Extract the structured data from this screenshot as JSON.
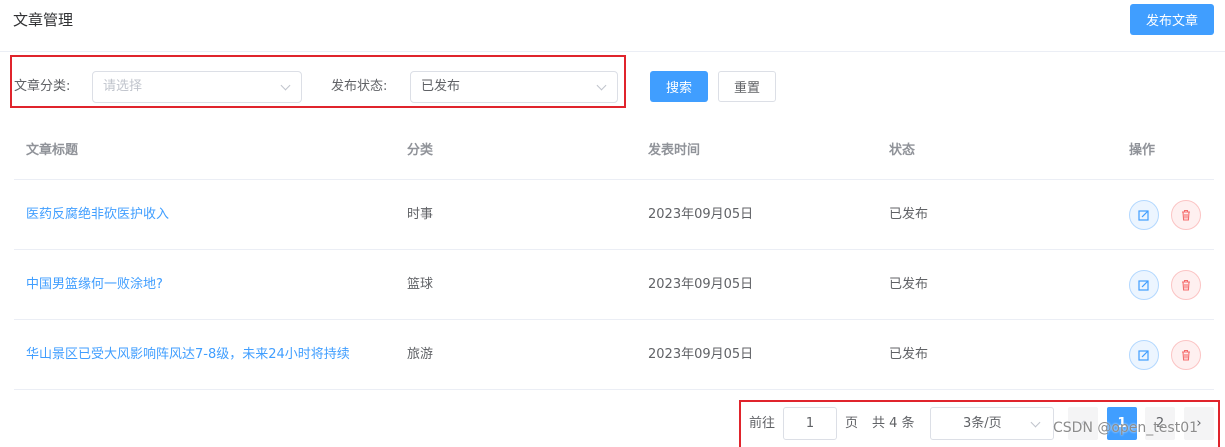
{
  "header": {
    "title": "文章管理",
    "publish_label": "发布文章"
  },
  "filters": {
    "category_label": "文章分类:",
    "category_placeholder": "请选择",
    "status_label": "发布状态:",
    "status_value": "已发布",
    "search_label": "搜索",
    "reset_label": "重置"
  },
  "table": {
    "columns": [
      "文章标题",
      "分类",
      "发表时间",
      "状态",
      "操作"
    ],
    "rows": [
      {
        "title": "医药反腐绝非砍医护收入",
        "category": "时事",
        "date": "2023年09月05日",
        "status": "已发布"
      },
      {
        "title": "中国男篮缘何一败涂地?",
        "category": "篮球",
        "date": "2023年09月05日",
        "status": "已发布"
      },
      {
        "title": "华山景区已受大风影响阵风达7-8级，未来24小时将持续",
        "category": "旅游",
        "date": "2023年09月05日",
        "status": "已发布"
      }
    ]
  },
  "pagination": {
    "goto_label": "前往",
    "goto_value": "1",
    "page_unit": "页",
    "total_label": "共 4 条",
    "page_size": "3条/页",
    "pages": [
      "1",
      "2"
    ],
    "current_page": "1",
    "prev_glyph": "‹",
    "next_glyph": "›"
  },
  "colors": {
    "primary": "#409eff",
    "danger": "#f56c6c",
    "highlight_box": "#e0242c"
  },
  "watermark": "CSDN @open_test01"
}
